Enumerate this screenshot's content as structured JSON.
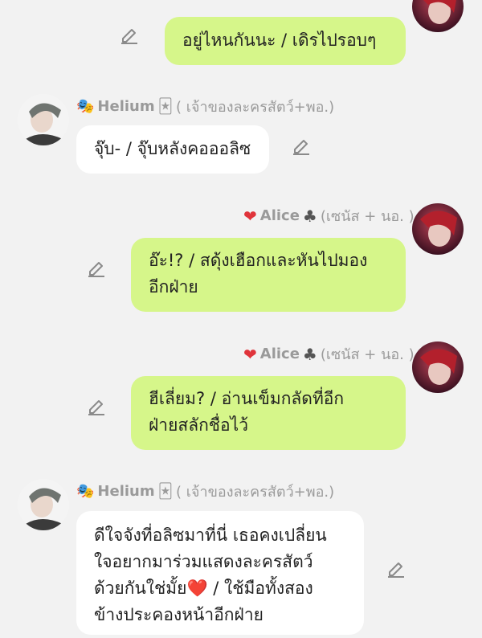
{
  "colors": {
    "background": "#f2f2f2",
    "outgoing_bubble": "#d6f68a",
    "incoming_bubble": "#ffffff",
    "name_text": "#9b9b9b",
    "heart": "#e0343b"
  },
  "messages": [
    {
      "side": "right",
      "sender_name": "",
      "sender_suffix": "",
      "text": "อยู่ไหนกันนะ / เดิรไปรอบๆ"
    },
    {
      "side": "left",
      "sender_emoji_before": "performing-arts-emoji",
      "sender_name": "Helium",
      "sender_emoji_after": "joker-card-emoji",
      "sender_suffix": "( เจ้าของละครสัตว์+พอ.)",
      "text": "จุ๊บ- / จุ๊บหลังคอออลิซ"
    },
    {
      "side": "right",
      "sender_emoji_before": "red-heart-emoji",
      "sender_name": "Alice",
      "sender_emoji_after": "club-suit-emoji",
      "sender_suffix": "(เซนัส + นอ. )",
      "text": "อ๊ะ!? / สดุ้งเฮือกและหันไปมอง\nอีกฝ่าย"
    },
    {
      "side": "right",
      "sender_emoji_before": "red-heart-emoji",
      "sender_name": "Alice",
      "sender_emoji_after": "club-suit-emoji",
      "sender_suffix": "(เซนัส + นอ. )",
      "text": "ฮีเลี่ยม? / อ่านเข็มกลัดที่อีก\nฝ่ายสลักชื่อไว้"
    },
    {
      "side": "left",
      "sender_emoji_before": "performing-arts-emoji",
      "sender_name": "Helium",
      "sender_emoji_after": "joker-card-emoji",
      "sender_suffix": "( เจ้าของละครสัตว์+พอ.)",
      "text": "ดีใจจังที่อลิซมาที่นี่ เธอคงเปลี่ยน\nใจอยากมาร่วมแสดงละครสัตว์\nด้วยกันใช่มั้ย❤️ / ใช้มือทั้งสอง\nข้างประคองหน้าอีกฝ่าย"
    }
  ]
}
